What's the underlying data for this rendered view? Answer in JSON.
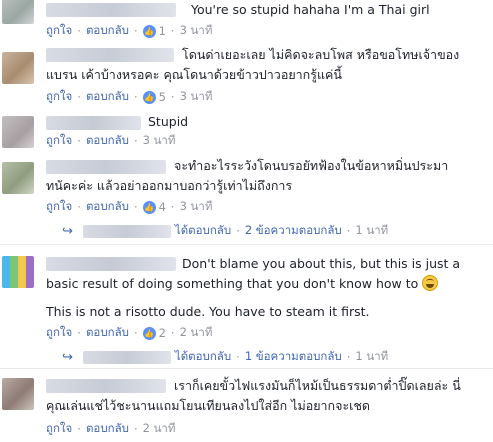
{
  "labels": {
    "like": "ถูกใจ",
    "reply": "ตอบกลับ",
    "replied": "ได้ตอบกลับ"
  },
  "comments": [
    {
      "line1": "You're so stupid hahaha I'm a Thai girl",
      "line2": "",
      "likes": "1",
      "time": "3 นาที"
    },
    {
      "line1": "โดนด่าเยอะเลย ไม่คิดจะลบโพส หรือขอโทษเจ้าของ",
      "line2": "แบรน เค้าบ้างหรอคะ คุณโดนาด้วยข้าวปาวอยากรู้แค่นี้",
      "likes": "5",
      "time": "3 นาที"
    },
    {
      "line1": "Stupid",
      "line2": "",
      "likes": "",
      "time": "3 นาที"
    },
    {
      "line1": "จะทำอะไรระวังโดนบรอยัทฟ้องในข้อหาหมิ่นประมา",
      "line2": "ทนัคะค่ะ แล้วอย่าออกมาบอกว่ารู้เท่าไม่ถึงการ",
      "likes": "4",
      "time": "3 นาที"
    },
    {
      "replies_text": "2 ข้อความตอบกลับ",
      "time": "1 นาที"
    },
    {
      "line1": "Don't blame you about this, but this is just a",
      "line2": "basic result of doing something that you don't know how to",
      "line3": "This is not a risotto dude. You have to steam it first.",
      "likes": "2",
      "time": "2 นาที"
    },
    {
      "replies_text": "1 ข้อความตอบกลับ",
      "time": "1 นาที"
    },
    {
      "line1": "เราก็เคยขั้วไฟแรงมันก็ไหม้เป็นธรรมดาต่ำปิ๊ดเลยล่ะ นี่",
      "line2": "คุณเล่นแช่ไว้ชะนานแถมโยนเทียนลงไปใส่อีก ไม่อยากจะเชด",
      "likes": "",
      "time": "2 นาที"
    }
  ],
  "colors": {
    "link": "#4267b2",
    "meta": "#90949c",
    "like_badge": "#5890ff"
  },
  "icons": [
    "like-icon",
    "reply-arrow-icon",
    "laughing-emoji-icon"
  ]
}
